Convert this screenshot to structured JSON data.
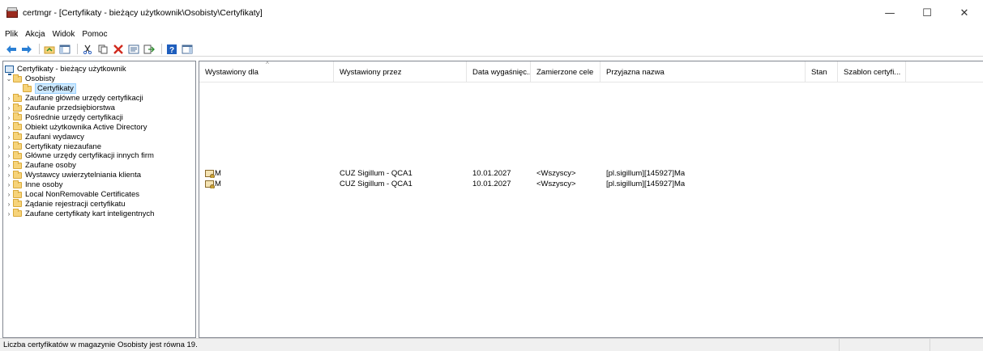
{
  "window": {
    "title": "certmgr - [Certyfikaty - bieżący użytkownik\\Osobisty\\Certyfikaty]",
    "minimize": "—",
    "maximize": "☐",
    "close": "✕"
  },
  "menu": [
    "Plik",
    "Akcja",
    "Widok",
    "Pomoc"
  ],
  "toolbar": {
    "icons": [
      "back-arrow-icon",
      "forward-arrow-icon",
      "up-folder-icon",
      "show-hide-tree-icon",
      "cut-icon",
      "copy-icon",
      "delete-icon",
      "properties-icon",
      "export-icon",
      "help-icon",
      "action-pane-icon"
    ]
  },
  "tree": {
    "root": "Certyfikaty - bieżący użytkownik",
    "items": [
      {
        "label": "Osobisty",
        "expanded": true
      },
      {
        "label": "Certyfikaty",
        "selected": true
      },
      {
        "label": "Zaufane główne urzędy certyfikacji"
      },
      {
        "label": "Zaufanie przedsiębiorstwa"
      },
      {
        "label": "Pośrednie urzędy certyfikacji"
      },
      {
        "label": "Obiekt użytkownika Active Directory"
      },
      {
        "label": "Zaufani wydawcy"
      },
      {
        "label": "Certyfikaty niezaufane"
      },
      {
        "label": "Główne urzędy certyfikacji innych firm"
      },
      {
        "label": "Zaufane osoby"
      },
      {
        "label": "Wystawcy uwierzytelniania klienta"
      },
      {
        "label": "Inne osoby"
      },
      {
        "label": "Local NonRemovable Certificates"
      },
      {
        "label": "Żądanie rejestracji certyfikatu"
      },
      {
        "label": "Zaufane certyfikaty kart inteligentnych"
      }
    ]
  },
  "list": {
    "columns": [
      "Wystawiony dla",
      "Wystawiony przez",
      "Data wygaśnięc...",
      "Zamierzone cele",
      "Przyjazna nazwa",
      "Stan",
      "Szablon certyfi..."
    ],
    "rows": [
      {
        "issued_to": "M",
        "issued_by": "CUZ Sigillum - QCA1",
        "expires": "10.01.2027",
        "purposes": "<Wszyscy>",
        "friendly": "[pl.sigillum][145927]Ma",
        "status": "",
        "template": ""
      },
      {
        "issued_to": "M",
        "issued_by": "CUZ Sigillum - QCA1",
        "expires": "10.01.2027",
        "purposes": "<Wszyscy>",
        "friendly": "[pl.sigillum][145927]Ma",
        "status": "",
        "template": ""
      }
    ]
  },
  "status": {
    "text": "Liczba certyfikatów w magazynie Osobisty jest równa 19."
  }
}
